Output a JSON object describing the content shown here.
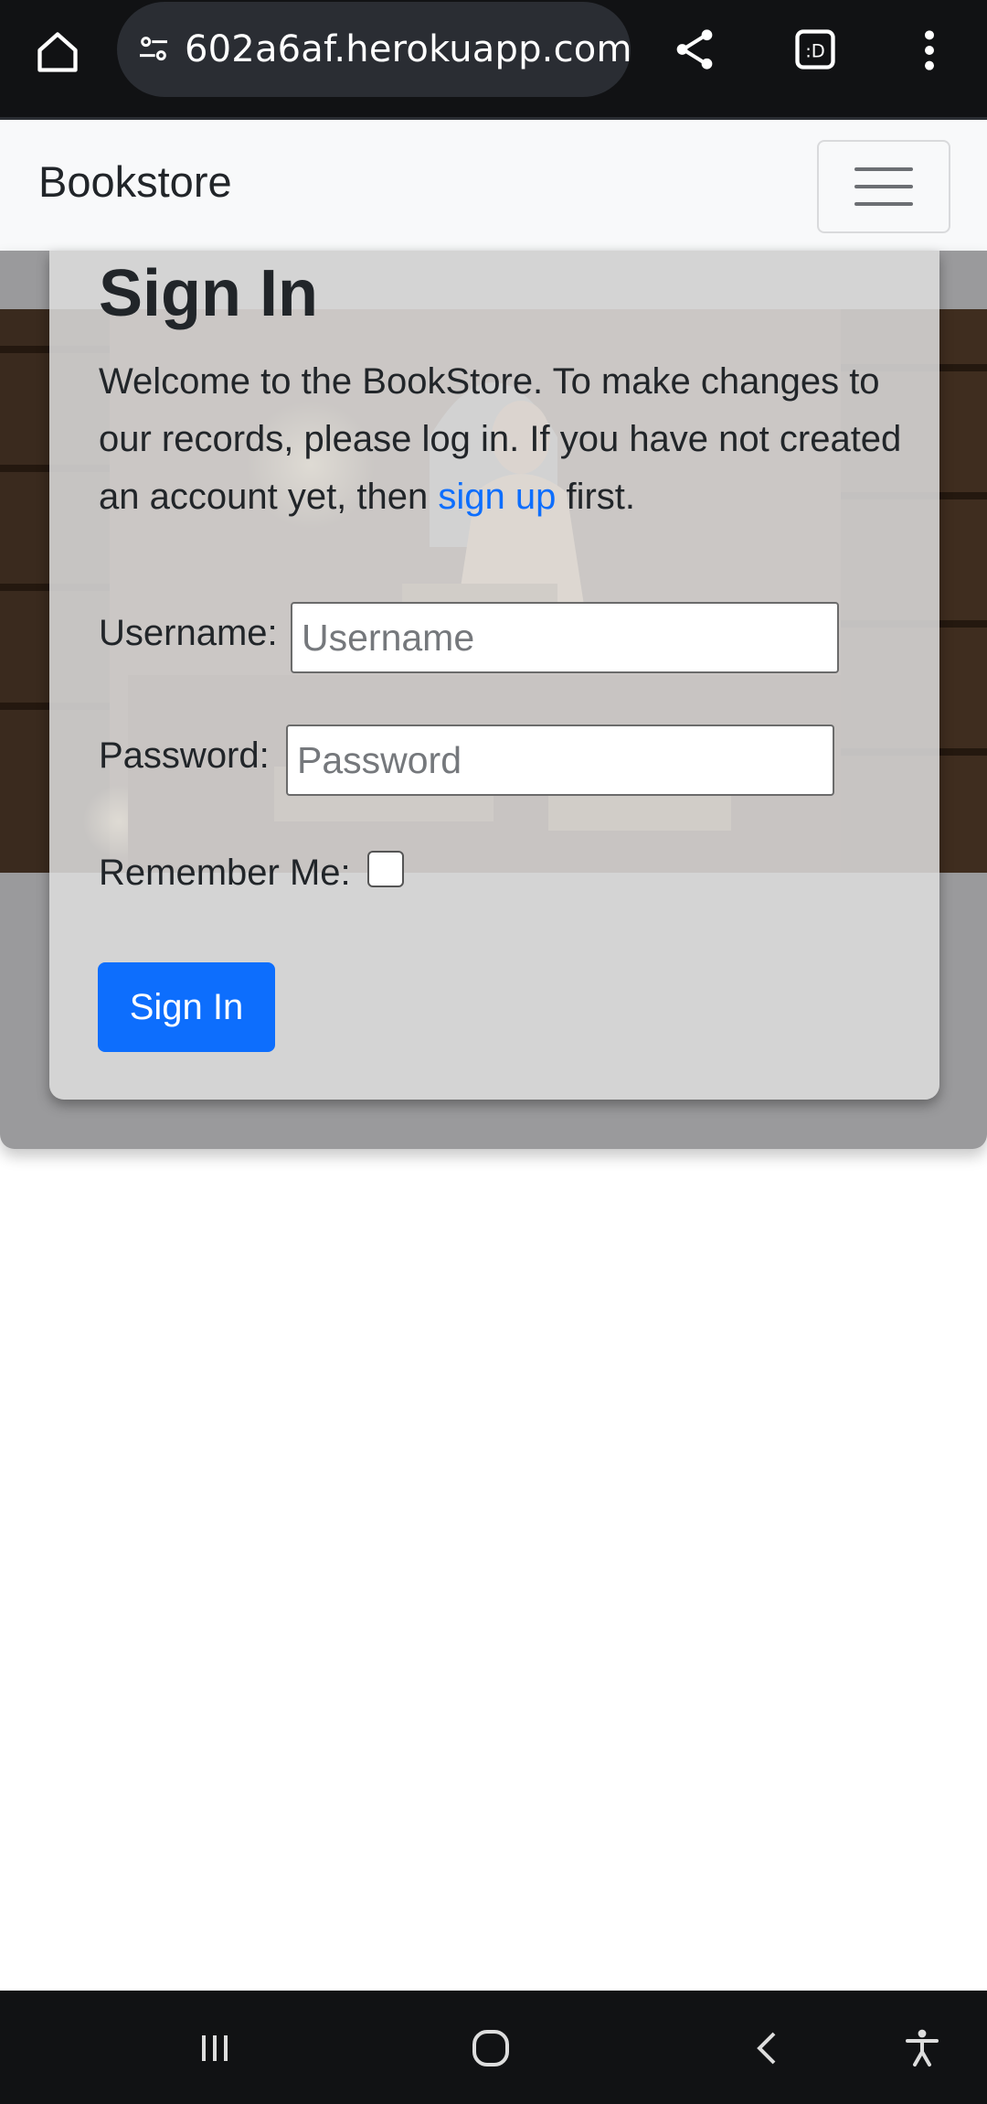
{
  "browser": {
    "url": "602a6af.herokuapp.com",
    "icons": [
      "home-icon",
      "site-settings-icon",
      "share-icon",
      "tabs-icon",
      "more-vert-icon"
    ]
  },
  "navbar": {
    "brand": "Bookstore",
    "toggler_icon": "hamburger-icon"
  },
  "signin": {
    "title": "Sign In",
    "intro_before": "Welcome to the BookStore. To make changes to our records, please log in. If you have not created an account yet, then ",
    "intro_link": "sign up",
    "intro_after": " first.",
    "username_label": "Username:",
    "username_placeholder": "Username",
    "password_label": "Password:",
    "password_placeholder": "Password",
    "remember_label": "Remember Me:",
    "remember_checked": false,
    "submit_label": "Sign In"
  },
  "colors": {
    "primary": "#0d6efd",
    "chrome": "#111214"
  },
  "system_nav": {
    "icons": [
      "recents-icon",
      "home-button-icon",
      "back-icon",
      "accessibility-icon"
    ]
  }
}
